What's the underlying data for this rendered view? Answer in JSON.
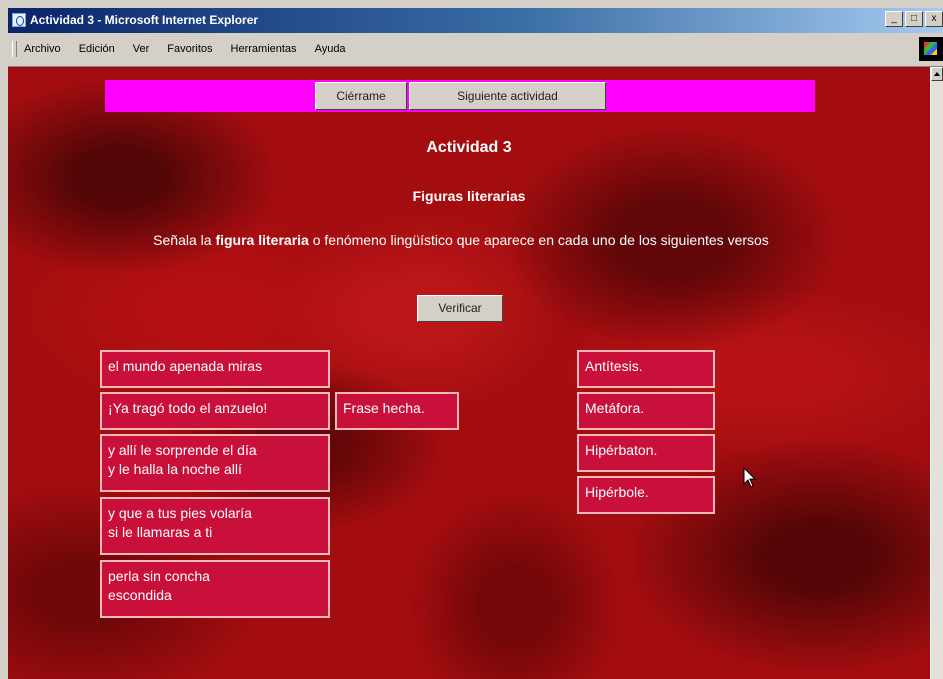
{
  "window": {
    "title": "Actividad 3 - Microsoft Internet Explorer",
    "buttons": [
      "_",
      "□",
      "x"
    ]
  },
  "menubar": {
    "items": [
      "Archivo",
      "Edición",
      "Ver",
      "Favoritos",
      "Herramientas",
      "Ayuda"
    ]
  },
  "page": {
    "nav": {
      "close_label": "Ciérrame",
      "next_label": "Siguiente actividad"
    },
    "title": "Actividad 3",
    "subtitle": "Figuras literarias",
    "instructions": {
      "before": "Señala la ",
      "bold": "figura literaria",
      "after": " o fenómeno lingüístico que aparece en cada uno de los siguientes versos"
    },
    "verify_label": "Verificar",
    "verses": [
      {
        "lines": [
          "el mundo apenada miras"
        ]
      },
      {
        "lines": [
          "¡Ya tragó todo el anzuelo!"
        ]
      },
      {
        "lines": [
          "y allí le sorprende el día",
          "y le halla la noche allí"
        ]
      },
      {
        "lines": [
          "y que a tus pies volaría",
          "si le llamaras a ti"
        ]
      },
      {
        "lines": [
          "perla sin concha",
          "escondida"
        ]
      }
    ],
    "placed_answer": "Frase hecha.",
    "answers": [
      "Antítesis.",
      "Metáfora.",
      "Hipérbaton.",
      "Hipérbole."
    ]
  }
}
